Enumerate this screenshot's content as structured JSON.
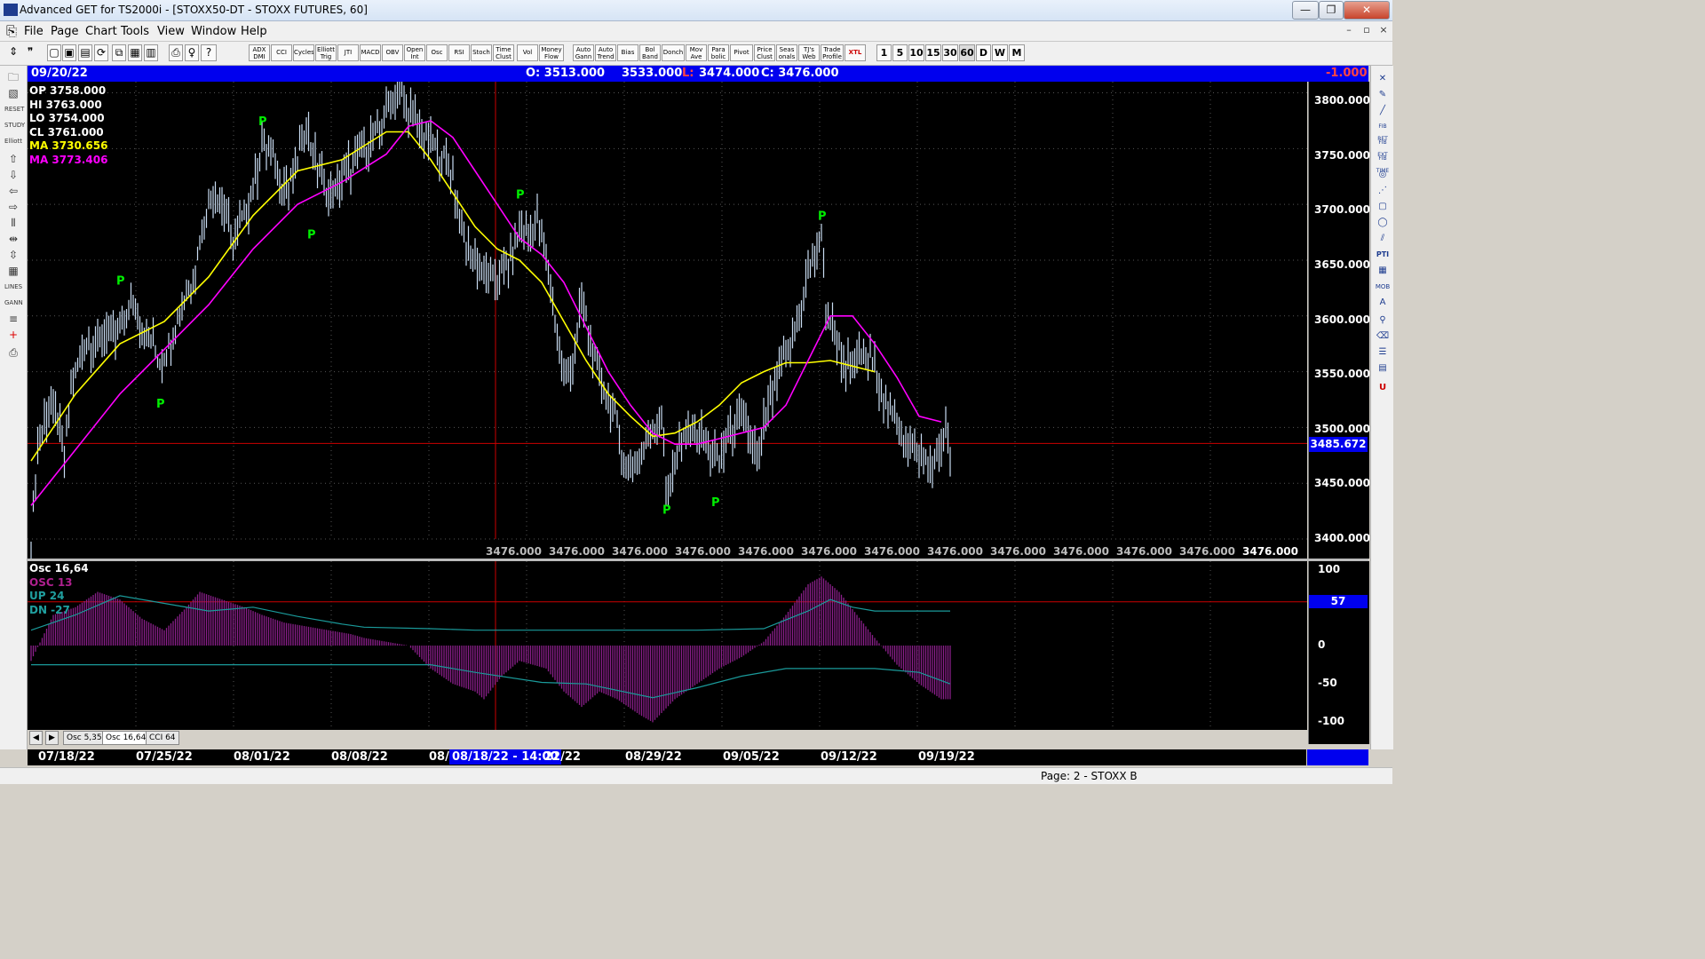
{
  "window": {
    "title": "Advanced GET for TS2000i - [STOXX50-DT - STOXX FUTURES, 60]",
    "controls": [
      "—",
      "❐",
      "✕"
    ]
  },
  "menu": [
    "File",
    "Page",
    "Chart",
    "Tools",
    "View",
    "Window",
    "Help"
  ],
  "mdi_controls": [
    "–",
    "▫",
    "×"
  ],
  "toolbar": {
    "indicators": [
      "ADX DMI",
      "CCI",
      "Cycles",
      "Elliott Trig",
      "JTI",
      "MACD",
      "OBV",
      "Open Int",
      "Osc",
      "RSI",
      "Stoch",
      "Time Clust",
      "Vol",
      "Money Flow"
    ],
    "tools": [
      "Auto Gann",
      "Auto Trend",
      "Bias",
      "Bol Band",
      "Donch",
      "Mov Ave",
      "Para bolic",
      "Pivot",
      "Price Clust",
      "Seas onals",
      "TJ's Web",
      "Trade Profile",
      "XTL"
    ],
    "intervals": [
      "1",
      "5",
      "10",
      "15",
      "30",
      "60",
      "D",
      "W",
      "M"
    ]
  },
  "infobar": {
    "date": "09/20/22",
    "open": "O: 3513.000",
    "high": "3533.000",
    "low_label": "L:",
    "low": "3474.000",
    "close": "C: 3476.000",
    "change": "-1.000"
  },
  "legend": {
    "op": "OP  3758.000",
    "hi": "HI   3763.000",
    "lo": "LO  3754.000",
    "cl": "CL  3761.000",
    "ma1": "MA  3730.656",
    "ma2": "MA  3773.406"
  },
  "price_axis": [
    "3800.000",
    "3750.000",
    "3700.000",
    "3650.000",
    "3600.000",
    "3550.000",
    "3500.000",
    "3450.000",
    "3400.000"
  ],
  "current_price": "3485.672",
  "bottom_row_label": "3476.000",
  "pivot_marker": "P",
  "osc_legend": {
    "title": "Osc 16,64",
    "osc": "OSC 13",
    "up": "UP   24",
    "dn": "DN   -27"
  },
  "osc_axis": [
    "100",
    "0",
    "-50",
    "-100"
  ],
  "osc_value": "57",
  "tabs": [
    "Osc 5,35",
    "Osc 16,64",
    "CCI 64"
  ],
  "dates": [
    "07/18/22",
    "07/25/22",
    "08/01/22",
    "08/08/22",
    "08/",
    "08/18/22 - 14:00",
    "22/22",
    "08/29/22",
    "09/05/22",
    "09/12/22",
    "09/19/22"
  ],
  "status": "Page: 2 - STOXX B",
  "colors": {
    "up_bar": "#c9dcf2",
    "ma_fast": "#ffff00",
    "ma_slow": "#ff00ff",
    "pivot": "#00ee00",
    "osc": "#8b1f8b",
    "osc_line": "#1a9a9a",
    "crosshair": "#cc0000"
  },
  "chart_data": {
    "type": "bar",
    "price_range": [
      3400,
      3810
    ],
    "osc_range": [
      -110,
      110
    ],
    "price_path": [
      [
        0,
        3400
      ],
      [
        3,
        3480
      ],
      [
        8,
        3520
      ],
      [
        12,
        3510
      ],
      [
        15,
        3470
      ],
      [
        18,
        3540
      ],
      [
        22,
        3560
      ],
      [
        26,
        3580
      ],
      [
        30,
        3570
      ],
      [
        34,
        3590
      ],
      [
        38,
        3580
      ],
      [
        42,
        3600
      ],
      [
        46,
        3610
      ],
      [
        50,
        3590
      ],
      [
        54,
        3580
      ],
      [
        58,
        3560
      ],
      [
        62,
        3570
      ],
      [
        66,
        3600
      ],
      [
        70,
        3620
      ],
      [
        74,
        3640
      ],
      [
        76,
        3670
      ],
      [
        80,
        3700
      ],
      [
        84,
        3710
      ],
      [
        88,
        3690
      ],
      [
        90,
        3670
      ],
      [
        94,
        3680
      ],
      [
        98,
        3700
      ],
      [
        102,
        3730
      ],
      [
        104,
        3760
      ],
      [
        108,
        3745
      ],
      [
        112,
        3720
      ],
      [
        116,
        3715
      ],
      [
        120,
        3740
      ],
      [
        124,
        3770
      ],
      [
        128,
        3740
      ],
      [
        132,
        3720
      ],
      [
        134,
        3705
      ],
      [
        138,
        3715
      ],
      [
        142,
        3730
      ],
      [
        146,
        3740
      ],
      [
        150,
        3750
      ],
      [
        154,
        3760
      ],
      [
        158,
        3770
      ],
      [
        162,
        3795
      ],
      [
        166,
        3800
      ],
      [
        170,
        3785
      ],
      [
        174,
        3770
      ],
      [
        178,
        3760
      ],
      [
        182,
        3750
      ],
      [
        186,
        3740
      ],
      [
        190,
        3725
      ],
      [
        192,
        3700
      ],
      [
        196,
        3660
      ],
      [
        200,
        3650
      ],
      [
        204,
        3640
      ],
      [
        208,
        3630
      ],
      [
        212,
        3640
      ],
      [
        216,
        3650
      ],
      [
        220,
        3680
      ],
      [
        224,
        3670
      ],
      [
        228,
        3690
      ],
      [
        232,
        3650
      ],
      [
        236,
        3600
      ],
      [
        240,
        3540
      ],
      [
        244,
        3560
      ],
      [
        248,
        3610
      ],
      [
        252,
        3580
      ],
      [
        256,
        3540
      ],
      [
        260,
        3530
      ],
      [
        264,
        3500
      ],
      [
        268,
        3460
      ],
      [
        272,
        3470
      ],
      [
        276,
        3480
      ],
      [
        280,
        3500
      ],
      [
        284,
        3510
      ],
      [
        286,
        3440
      ],
      [
        290,
        3470
      ],
      [
        294,
        3490
      ],
      [
        298,
        3500
      ],
      [
        302,
        3490
      ],
      [
        306,
        3480
      ],
      [
        310,
        3470
      ],
      [
        314,
        3490
      ],
      [
        318,
        3510
      ],
      [
        322,
        3500
      ],
      [
        326,
        3480
      ],
      [
        328,
        3470
      ],
      [
        330,
        3500
      ],
      [
        334,
        3530
      ],
      [
        338,
        3560
      ],
      [
        342,
        3570
      ],
      [
        346,
        3600
      ],
      [
        350,
        3640
      ],
      [
        354,
        3660
      ],
      [
        356,
        3670
      ],
      [
        358,
        3610
      ],
      [
        362,
        3580
      ],
      [
        366,
        3560
      ],
      [
        370,
        3550
      ],
      [
        374,
        3570
      ],
      [
        378,
        3560
      ],
      [
        382,
        3540
      ],
      [
        386,
        3520
      ],
      [
        390,
        3500
      ],
      [
        394,
        3490
      ],
      [
        398,
        3480
      ],
      [
        402,
        3470
      ],
      [
        406,
        3465
      ],
      [
        408,
        3470
      ],
      [
        412,
        3500
      ],
      [
        414,
        3476
      ]
    ],
    "ma_fast": [
      [
        0,
        3470
      ],
      [
        20,
        3530
      ],
      [
        40,
        3575
      ],
      [
        60,
        3595
      ],
      [
        80,
        3635
      ],
      [
        100,
        3690
      ],
      [
        120,
        3730
      ],
      [
        140,
        3740
      ],
      [
        160,
        3765
      ],
      [
        170,
        3765
      ],
      [
        180,
        3740
      ],
      [
        190,
        3710
      ],
      [
        200,
        3680
      ],
      [
        210,
        3660
      ],
      [
        220,
        3650
      ],
      [
        230,
        3630
      ],
      [
        240,
        3595
      ],
      [
        250,
        3560
      ],
      [
        260,
        3530
      ],
      [
        270,
        3510
      ],
      [
        280,
        3492
      ],
      [
        290,
        3495
      ],
      [
        300,
        3505
      ],
      [
        310,
        3520
      ],
      [
        320,
        3540
      ],
      [
        330,
        3550
      ],
      [
        340,
        3558
      ],
      [
        350,
        3558
      ],
      [
        360,
        3560
      ],
      [
        370,
        3555
      ],
      [
        380,
        3550
      ]
    ],
    "ma_slow": [
      [
        0,
        3430
      ],
      [
        20,
        3480
      ],
      [
        40,
        3530
      ],
      [
        60,
        3570
      ],
      [
        80,
        3610
      ],
      [
        100,
        3660
      ],
      [
        120,
        3700
      ],
      [
        140,
        3720
      ],
      [
        160,
        3745
      ],
      [
        170,
        3770
      ],
      [
        180,
        3775
      ],
      [
        190,
        3760
      ],
      [
        200,
        3730
      ],
      [
        210,
        3700
      ],
      [
        220,
        3670
      ],
      [
        230,
        3655
      ],
      [
        240,
        3630
      ],
      [
        250,
        3590
      ],
      [
        260,
        3550
      ],
      [
        270,
        3520
      ],
      [
        280,
        3495
      ],
      [
        290,
        3485
      ],
      [
        300,
        3485
      ],
      [
        310,
        3490
      ],
      [
        320,
        3495
      ],
      [
        330,
        3500
      ],
      [
        340,
        3520
      ],
      [
        350,
        3560
      ],
      [
        360,
        3600
      ],
      [
        370,
        3600
      ],
      [
        380,
        3575
      ],
      [
        390,
        3545
      ],
      [
        400,
        3510
      ],
      [
        410,
        3505
      ]
    ],
    "pivots": [
      [
        40,
        3625,
        "high"
      ],
      [
        58,
        3528,
        "low"
      ],
      [
        104,
        3768,
        "high"
      ],
      [
        126,
        3680,
        "low"
      ],
      [
        220,
        3702,
        "high"
      ],
      [
        286,
        3433,
        "low"
      ],
      [
        308,
        3440,
        "low"
      ],
      [
        356,
        3683,
        "high"
      ]
    ],
    "osc_path": [
      [
        0,
        -20
      ],
      [
        10,
        40
      ],
      [
        20,
        50
      ],
      [
        30,
        70
      ],
      [
        40,
        60
      ],
      [
        50,
        35
      ],
      [
        60,
        20
      ],
      [
        70,
        50
      ],
      [
        76,
        70
      ],
      [
        86,
        60
      ],
      [
        96,
        50
      ],
      [
        104,
        40
      ],
      [
        114,
        30
      ],
      [
        124,
        25
      ],
      [
        134,
        20
      ],
      [
        144,
        15
      ],
      [
        150,
        10
      ],
      [
        160,
        5
      ],
      [
        170,
        0
      ],
      [
        180,
        -30
      ],
      [
        190,
        -50
      ],
      [
        200,
        -60
      ],
      [
        204,
        -70
      ],
      [
        212,
        -40
      ],
      [
        220,
        -20
      ],
      [
        232,
        -30
      ],
      [
        240,
        -60
      ],
      [
        248,
        -80
      ],
      [
        256,
        -60
      ],
      [
        264,
        -70
      ],
      [
        274,
        -90
      ],
      [
        280,
        -100
      ],
      [
        290,
        -70
      ],
      [
        300,
        -50
      ],
      [
        310,
        -30
      ],
      [
        320,
        -15
      ],
      [
        330,
        5
      ],
      [
        340,
        40
      ],
      [
        350,
        80
      ],
      [
        356,
        90
      ],
      [
        364,
        70
      ],
      [
        372,
        40
      ],
      [
        380,
        10
      ],
      [
        390,
        -25
      ],
      [
        400,
        -50
      ],
      [
        410,
        -70
      ],
      [
        414,
        -70
      ]
    ],
    "osc_up": [
      [
        0,
        20
      ],
      [
        20,
        40
      ],
      [
        40,
        65
      ],
      [
        60,
        55
      ],
      [
        80,
        45
      ],
      [
        100,
        50
      ],
      [
        120,
        38
      ],
      [
        140,
        28
      ],
      [
        150,
        24
      ],
      [
        180,
        22
      ],
      [
        200,
        20
      ],
      [
        250,
        20
      ],
      [
        300,
        20
      ],
      [
        330,
        22
      ],
      [
        350,
        45
      ],
      [
        360,
        60
      ],
      [
        370,
        50
      ],
      [
        380,
        45
      ],
      [
        414,
        45
      ]
    ],
    "osc_dn": [
      [
        0,
        -25
      ],
      [
        60,
        -25
      ],
      [
        120,
        -25
      ],
      [
        160,
        -25
      ],
      [
        180,
        -25
      ],
      [
        200,
        -35
      ],
      [
        230,
        -48
      ],
      [
        250,
        -50
      ],
      [
        280,
        -68
      ],
      [
        300,
        -55
      ],
      [
        320,
        -40
      ],
      [
        340,
        -30
      ],
      [
        380,
        -30
      ],
      [
        400,
        -35
      ],
      [
        414,
        -50
      ]
    ]
  }
}
